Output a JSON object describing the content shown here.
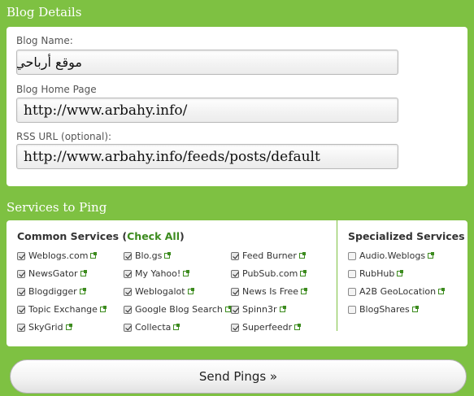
{
  "blog_details": {
    "title": "Blog Details",
    "name_label": "Blog Name:",
    "name_value": "موقع أرباحي",
    "home_label": "Blog Home Page",
    "home_value": "http://www.arbahy.info/",
    "rss_label": "RSS URL (optional):",
    "rss_value": "http://www.arbahy.info/feeds/posts/default"
  },
  "services": {
    "title": "Services to Ping",
    "common_title": "Common Services (",
    "check_all": "Check All",
    "common_title_end": ")",
    "specialized_title": "Specialized Services",
    "common": [
      {
        "label": "Weblogs.com",
        "checked": true
      },
      {
        "label": "NewsGator",
        "checked": true
      },
      {
        "label": "Blogdigger",
        "checked": true
      },
      {
        "label": "Topic Exchange",
        "checked": true
      },
      {
        "label": "SkyGrid",
        "checked": true
      },
      {
        "label": "Blo.gs",
        "checked": true
      },
      {
        "label": "My Yahoo!",
        "checked": true
      },
      {
        "label": "Weblogalot",
        "checked": true
      },
      {
        "label": "Google Blog Search",
        "checked": true
      },
      {
        "label": "Collecta",
        "checked": true
      },
      {
        "label": "Feed Burner",
        "checked": true
      },
      {
        "label": "PubSub.com",
        "checked": true
      },
      {
        "label": "News Is Free",
        "checked": true
      },
      {
        "label": "Spinn3r",
        "checked": true
      },
      {
        "label": "Superfeedr",
        "checked": true
      }
    ],
    "specialized": [
      {
        "label": "Audio.Weblogs",
        "checked": false
      },
      {
        "label": "RubHub",
        "checked": false
      },
      {
        "label": "A2B GeoLocation",
        "checked": false
      },
      {
        "label": "BlogShares",
        "checked": false
      }
    ]
  },
  "send_button": "Send Pings »",
  "colors": {
    "background": "#7ec142",
    "link": "#3c8b1e",
    "arrow": "#ff0000"
  }
}
